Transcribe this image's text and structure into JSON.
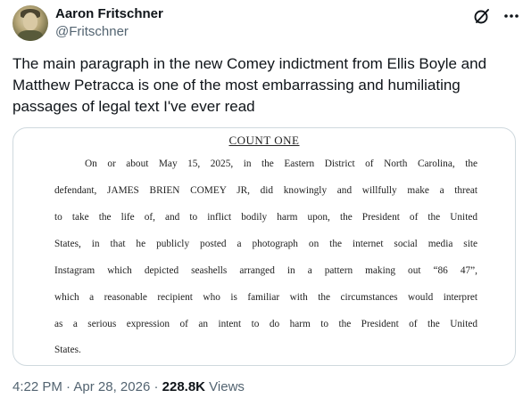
{
  "author": {
    "name": "Aaron Fritschner",
    "handle": "@Fritschner",
    "avatar_icon": "profile-photo"
  },
  "actions": {
    "grok_icon": "grok-slash-icon",
    "more_icon": "more-horizontal-icon"
  },
  "tweet": {
    "text": "The main paragraph in the new Comey indictment from Ellis Boyle and Matthew Petracca is one of the most embarrassing and humiliating passages of legal text I've ever read"
  },
  "document": {
    "heading": "COUNT ONE",
    "lines": [
      "On or about May 15, 2025, in the Eastern District of North Carolina, the",
      "defendant, JAMES BRIEN COMEY JR, did knowingly and willfully make a threat",
      "to take the life of, and to inflict bodily harm upon, the President of the United",
      "States, in that he publicly posted a photograph on the internet social media site",
      "Instagram which depicted seashells arranged in a pattern making out “86 47”,",
      "which a reasonable recipient who is familiar with the circumstances would interpret",
      "as a serious expression of an intent to do harm to the President of the United",
      "States."
    ]
  },
  "meta": {
    "time": "4:22 PM",
    "separator1": " · ",
    "date": "Apr 28, 2026",
    "separator2": " · ",
    "views_count": "228.8K",
    "views_label": " Views"
  }
}
